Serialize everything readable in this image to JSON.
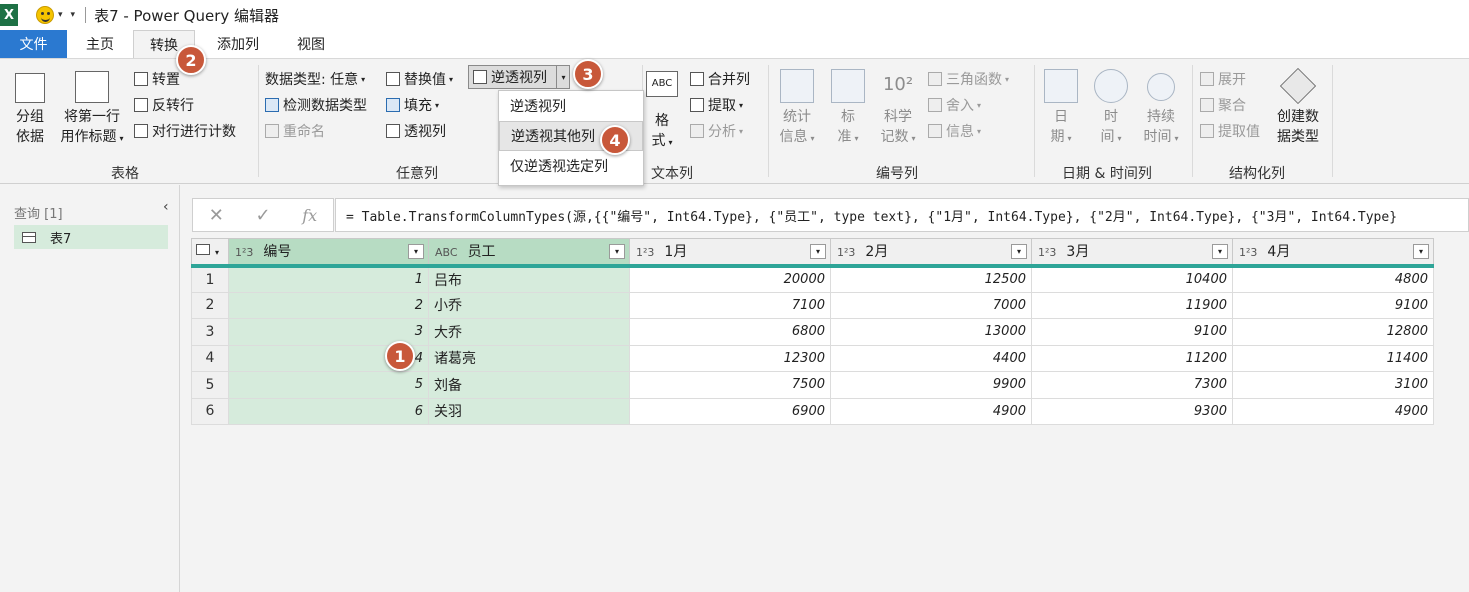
{
  "titlebar": {
    "app_icon": "X",
    "title": "表7 - Power Query 编辑器"
  },
  "tabs": [
    "文件",
    "主页",
    "转换",
    "添加列",
    "视图"
  ],
  "ribbon": {
    "table_group": {
      "label": "表格",
      "group_by_1": "分组",
      "group_by_2": "依据",
      "first_row_1": "将第一行",
      "first_row_2": "用作标题",
      "transpose": "转置",
      "reverse_rows": "反转行",
      "count_rows": "对行进行计数"
    },
    "anycol_group": {
      "label": "任意列",
      "data_type": "数据类型: 任意",
      "detect_type": "检测数据类型",
      "rename": "重命名",
      "replace": "替换值",
      "fill": "填充",
      "pivot": "透视列",
      "unpivot": "逆透视列"
    },
    "unpivot_menu": [
      "逆透视列",
      "逆透视其他列",
      "仅逆透视选定列"
    ],
    "text_group": {
      "label": "文本列",
      "format_1": "格",
      "format_2": "式",
      "merge": "合并列",
      "extract": "提取",
      "parse": "分析",
      "abc_icon": "ABC"
    },
    "number_group": {
      "label": "编号列",
      "stats_1": "统计",
      "stats_2": "信息",
      "standard_1": "标",
      "standard_2": "准",
      "scientific_1": "科学",
      "scientific_2": "记数",
      "trig": "三角函数",
      "round": "舍入",
      "info": "信息",
      "sci_icon": "10²"
    },
    "datetime_group": {
      "label": "日期 & 时间列",
      "date_1": "日",
      "date_2": "期",
      "time_1": "时",
      "time_2": "间",
      "duration_1": "持续",
      "duration_2": "时间"
    },
    "struct_group": {
      "label": "结构化列",
      "expand": "展开",
      "aggregate": "聚合",
      "extract_values": "提取值",
      "create_type_1": "创建数",
      "create_type_2": "据类型"
    }
  },
  "query_panel": {
    "header": "查询 [1]",
    "item": "表7"
  },
  "formula": "= Table.TransformColumnTypes(源,{{\"编号\", Int64.Type}, {\"员工\", type text}, {\"1月\", Int64.Type}, {\"2月\", Int64.Type}, {\"3月\", Int64.Type}",
  "formula_btns": [
    "✕",
    "✓",
    "fx"
  ],
  "grid": {
    "columns": [
      {
        "type": "1²3",
        "name": "编号"
      },
      {
        "type": "ABC",
        "name": "员工"
      },
      {
        "type": "1²3",
        "name": "1月"
      },
      {
        "type": "1²3",
        "name": "2月"
      },
      {
        "type": "1²3",
        "name": "3月"
      },
      {
        "type": "1²3",
        "name": "4月"
      }
    ],
    "rows": [
      [
        "1",
        "1",
        "吕布",
        "20000",
        "12500",
        "10400",
        "4800"
      ],
      [
        "2",
        "2",
        "小乔",
        "7100",
        "7000",
        "11900",
        "9100"
      ],
      [
        "3",
        "3",
        "大乔",
        "6800",
        "13000",
        "9100",
        "12800"
      ],
      [
        "4",
        "4",
        "诸葛亮",
        "12300",
        "4400",
        "11200",
        "11400"
      ],
      [
        "5",
        "5",
        "刘备",
        "7500",
        "9900",
        "7300",
        "3100"
      ],
      [
        "6",
        "6",
        "关羽",
        "6900",
        "4900",
        "9300",
        "4900"
      ]
    ]
  },
  "badges": [
    "1",
    "2",
    "3",
    "4"
  ]
}
